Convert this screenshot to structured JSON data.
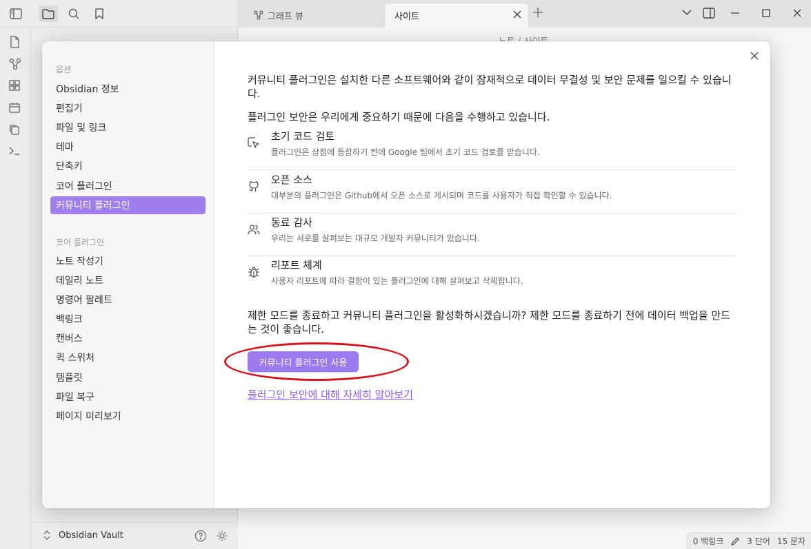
{
  "tabs": [
    {
      "label": "그래프 뷰",
      "icon": "graph-icon"
    },
    {
      "label": "사이트",
      "icon": "close-icon"
    }
  ],
  "breadcrumb": {
    "text": "노트 / 사이트"
  },
  "vault": {
    "name": "Obsidian Vault"
  },
  "status_bar": {
    "backlinks": "0 백링크",
    "words": "3 단어",
    "chars": "15 문자"
  },
  "settings": {
    "options_title": "옵션",
    "options": [
      "Obsidian 정보",
      "편집기",
      "파일 및 링크",
      "테마",
      "단축키",
      "코어 플러그인",
      "커뮤니티 플러그인"
    ],
    "active_option": "커뮤니티 플러그인",
    "core_title": "코어 플러그인",
    "core_plugins": [
      "노트 작성기",
      "데일리 노트",
      "명령어 팔레트",
      "백링크",
      "캔버스",
      "퀵 스위처",
      "템플릿",
      "파일 복구",
      "페이지 미리보기"
    ]
  },
  "content": {
    "warning": "커뮤니티 플러그인은 설치한 다른 소프트웨어와 같이 잠재적으로 데이터 무결성 및 보안 문제를 일으킬 수 있습니다.",
    "intro": "플러그인 보안은 우리에게 중요하기 때문에 다음을 수행하고 있습니다.",
    "features": [
      {
        "title": "초기 코드 검토",
        "desc": "플러그인은 상점에 등장하기 전에 Google 팀에서 초기 코드 검토를 받습니다.",
        "icon": "cursor-check-icon"
      },
      {
        "title": "오픈 소스",
        "desc": "대부분의 플러그인은 Github에서 오픈 소스로 게시되며 코드를 사용자가 직접 확인할 수 있습니다.",
        "icon": "github-icon"
      },
      {
        "title": "동료 감사",
        "desc": "우리는 서로를 살펴보는 대규모 개발자 커뮤니티가 있습니다.",
        "icon": "users-icon"
      },
      {
        "title": "리포트 체계",
        "desc": "사용자 리포트에 따라 결함이 있는 플러그인에 대해 살펴보고 삭제합니다.",
        "icon": "bug-icon"
      }
    ],
    "question": "제한 모드를 종료하고 커뮤니티 플러그인을 활성화하시겠습니까? 제한 모드를 종료하기 전에 데이터 백업을 만드는 것이 좋습니다.",
    "enable_button": "커뮤니티 플러그인 사용",
    "learn_more": "플러그인 보안에 대해 자세히 알아보기"
  },
  "colors": {
    "accent": "#9b7af0",
    "highlight_ellipse": "#d4141c",
    "link": "#8a5cf5"
  }
}
